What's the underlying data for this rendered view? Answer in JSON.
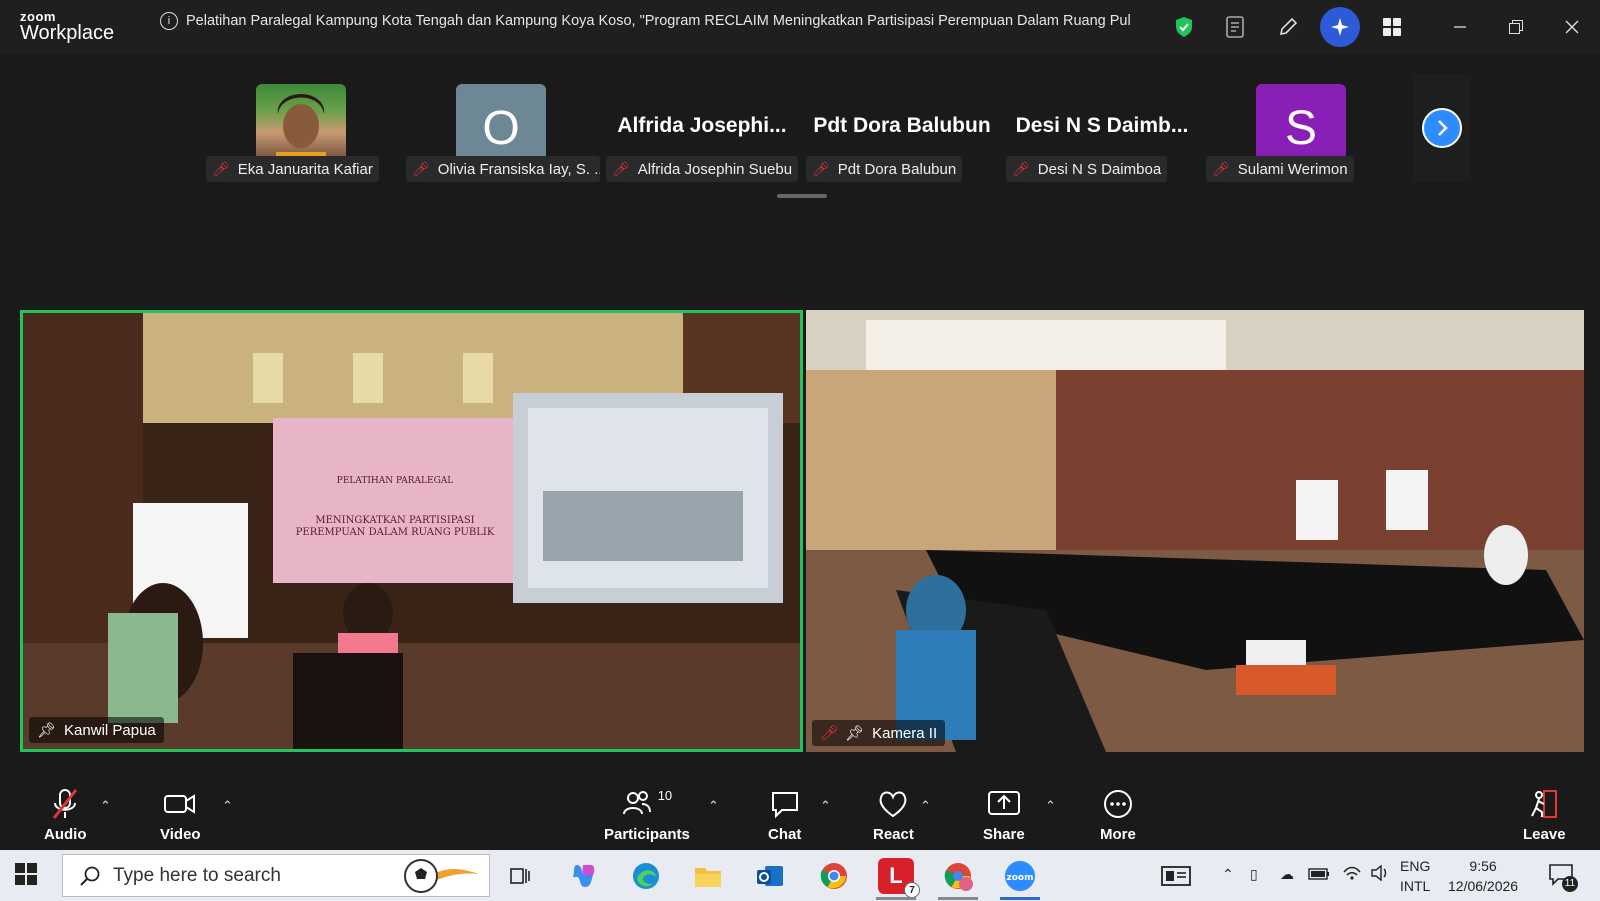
{
  "app": {
    "brand_small": "zoom",
    "brand_large": "Workplace"
  },
  "meeting": {
    "title": "Pelatihan Paralegal Kampung Kota Tengah dan Kampung Koya Koso, \"Program RECLAIM Meningkatkan Partisipasi Perempuan Dalam Ruang Pul"
  },
  "participants_strip": [
    {
      "name": "Eka Januarita Kafiar",
      "avatar": "photo",
      "muted": true
    },
    {
      "name": "Olivia Fransiska Iay, S. ...",
      "avatar_letter": "O",
      "avatar_color": "#6e8794",
      "muted": true
    },
    {
      "name": "Alfrida Josephin Suebu",
      "display_name": "Alfrida  Josephi...",
      "muted": true
    },
    {
      "name": "Pdt Dora Balubun",
      "display_name": "Pdt Dora Balubun",
      "muted": true
    },
    {
      "name": "Desi N S Daimboa",
      "display_name": "Desi N S Daimb...",
      "muted": true
    },
    {
      "name": "Sulami Werimon",
      "avatar_letter": "S",
      "avatar_color": "#8a1fb8",
      "muted": true
    }
  ],
  "videos": [
    {
      "label": "Kanwil Papua",
      "active_speaker": true
    },
    {
      "label": "Kamera II",
      "muted": true
    }
  ],
  "toolbar": {
    "audio": "Audio",
    "video": "Video",
    "participants": "Participants",
    "participants_count": "10",
    "chat": "Chat",
    "react": "React",
    "share": "Share",
    "more": "More",
    "leave": "Leave"
  },
  "taskbar": {
    "search_placeholder": "Type here to search",
    "lang_top": "ENG",
    "lang_bottom": "INTL",
    "time": "9:56",
    "date": "12/06/2026",
    "badge_l": "7",
    "notif_count": "11"
  },
  "colors": {
    "active_speaker_border": "#21c35c",
    "accent": "#2d8cff",
    "muted": "#e23636"
  }
}
